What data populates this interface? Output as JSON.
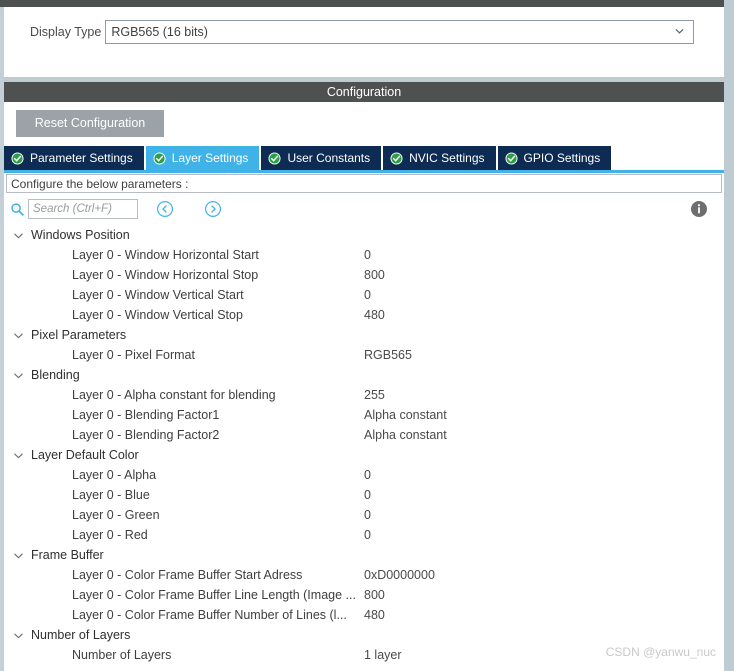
{
  "window": {
    "display_type_label": "Display Type",
    "display_type_value": "RGB565 (16 bits)",
    "config_title": "Configuration"
  },
  "toolbar": {
    "reset_label": "Reset Configuration"
  },
  "tabs": [
    {
      "label": "Parameter Settings",
      "active": false,
      "icon": "check-circle-icon"
    },
    {
      "label": "Layer Settings",
      "active": true,
      "icon": "check-circle-icon"
    },
    {
      "label": "User Constants",
      "active": false,
      "icon": "check-circle-icon"
    },
    {
      "label": "NVIC Settings",
      "active": false,
      "icon": "check-circle-icon"
    },
    {
      "label": "GPIO Settings",
      "active": false,
      "icon": "check-circle-icon"
    }
  ],
  "configure_bar": {
    "text": "Configure the below parameters :"
  },
  "search": {
    "placeholder": "Search (Ctrl+F)",
    "value": "",
    "icon": "search-icon",
    "prev_icon": "chevron-left-circle-icon",
    "next_icon": "chevron-right-circle-icon",
    "info_icon": "info-icon"
  },
  "tree": [
    {
      "group": "Windows Position",
      "expanded": true,
      "rows": [
        {
          "name": "Layer 0 - Window Horizontal Start",
          "value": "0"
        },
        {
          "name": "Layer 0 - Window Horizontal Stop",
          "value": "800"
        },
        {
          "name": "Layer 0 - Window Vertical Start",
          "value": "0"
        },
        {
          "name": "Layer 0 - Window Vertical Stop",
          "value": "480"
        }
      ]
    },
    {
      "group": "Pixel Parameters",
      "expanded": true,
      "rows": [
        {
          "name": "Layer 0 - Pixel Format",
          "value": "RGB565"
        }
      ]
    },
    {
      "group": "Blending",
      "expanded": true,
      "rows": [
        {
          "name": "Layer 0 - Alpha constant for blending",
          "value": "255"
        },
        {
          "name": "Layer 0 - Blending Factor1",
          "value": "Alpha constant"
        },
        {
          "name": "Layer 0 - Blending Factor2",
          "value": "Alpha constant"
        }
      ]
    },
    {
      "group": "Layer Default Color",
      "expanded": true,
      "rows": [
        {
          "name": "Layer 0 - Alpha",
          "value": "0"
        },
        {
          "name": "Layer 0 - Blue",
          "value": "0"
        },
        {
          "name": "Layer 0 - Green",
          "value": "0"
        },
        {
          "name": "Layer 0 - Red",
          "value": "0"
        }
      ]
    },
    {
      "group": "Frame Buffer",
      "expanded": true,
      "rows": [
        {
          "name": "Layer 0 - Color Frame Buffer Start Adress",
          "value": "0xD0000000"
        },
        {
          "name": "Layer 0 - Color Frame Buffer Line Length (Image ...",
          "value": "800"
        },
        {
          "name": "Layer 0 - Color Frame Buffer Number of Lines (l...",
          "value": "480"
        }
      ]
    },
    {
      "group": "Number of Layers",
      "expanded": true,
      "rows": [
        {
          "name": "Number of Layers",
          "value": "1 layer"
        }
      ]
    }
  ],
  "watermark": "CSDN @yanwu_nuc",
  "colors": {
    "tab_inactive": "#0d2b53",
    "tab_active": "#3fb3e8",
    "accent": "#3fb3e8",
    "header_bar": "#4f5150",
    "reset_button": "#9ba2a8",
    "check_green": "#2a9f45"
  }
}
